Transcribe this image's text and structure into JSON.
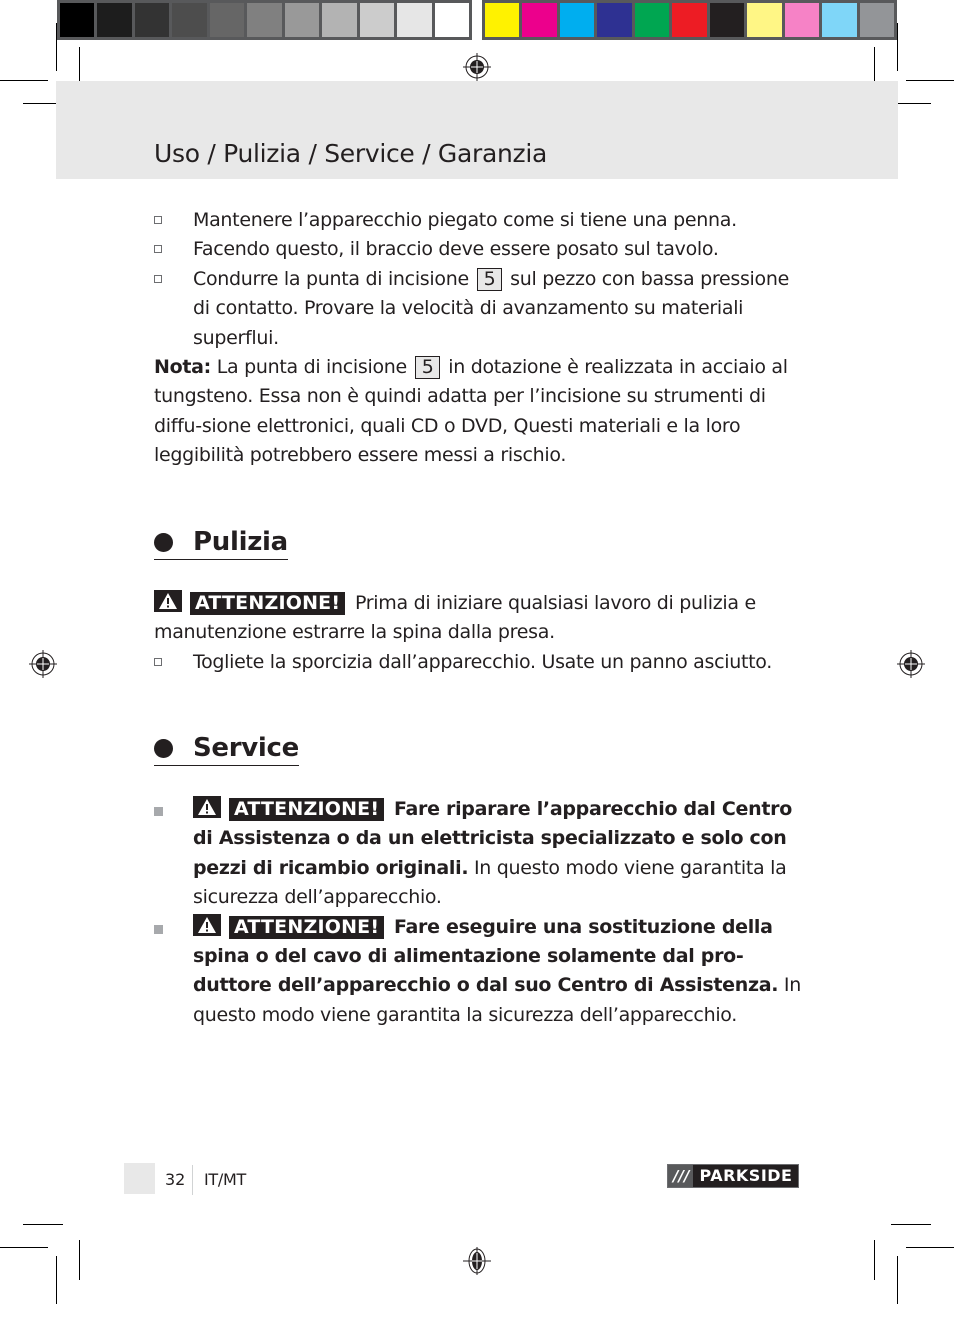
{
  "print_marks": {
    "gray_swatches": [
      "#000000",
      "#1d1d1d",
      "#333333",
      "#4d4d4d",
      "#666666",
      "#808080",
      "#999999",
      "#b3b3b3",
      "#cccccc",
      "#e6e6e6",
      "#ffffff"
    ],
    "color_swatches": [
      "#fff200",
      "#ec008c",
      "#00aeef",
      "#2e3192",
      "#00a651",
      "#ed1c24",
      "#231f20",
      "#fff685",
      "#f682c6",
      "#7fd6f8",
      "#939598"
    ]
  },
  "header": {
    "title": "Uso / Pulizia / Service / Garanzia"
  },
  "uso": {
    "items": [
      {
        "text": "Mantenere l’apparecchio piegato come si tiene una penna."
      },
      {
        "text": "Facendo questo, il braccio deve essere posato sul tavolo."
      },
      {
        "text_before": "Condurre la punta di incisione",
        "ref": "5",
        "text_after": "sul pezzo con bassa pressione di contatto. Provare la velocità di avanzamento su materiali superflui."
      }
    ],
    "note": {
      "label": "Nota:",
      "text_before": "La punta di incisione",
      "ref": "5",
      "text_after": "in dotazione è realizzata in acciaio al tungsteno. Essa non è quindi adatta per l’incisione su strumenti di diffu-sione elettronici, quali CD o DVD, Questi materiali e la loro leggibilità potrebbero essere messi a rischio."
    }
  },
  "pulizia": {
    "heading": "Pulizia",
    "warning_label": "ATTENZIONE!",
    "warning_text": "Prima di iniziare qualsiasi lavoro di pulizia e manutenzione estrarre la spina dalla presa.",
    "items": [
      {
        "text": "Togliete la sporcizia dall’apparecchio. Usate un panno asciutto."
      }
    ]
  },
  "service": {
    "heading": "Service",
    "items": [
      {
        "warning_label": "ATTENZIONE!",
        "bold_text": "Fare riparare l’apparecchio dal Centro di Assistenza o da un elettricista specializzato e solo con pezzi di ricambio originali.",
        "text": "In questo modo viene garantita la sicurezza dell’apparecchio."
      },
      {
        "warning_label": "ATTENZIONE!",
        "bold_text": "Fare eseguire una sostituzione della spina o del cavo di alimentazione solamente dal pro-duttore dell’apparecchio o dal suo Centro di Assistenza.",
        "text": "In questo modo viene garantita la sicurezza dell’apparecchio."
      }
    ]
  },
  "footer": {
    "page_number": "32",
    "locale": "IT/MT",
    "brand_slashes": "///",
    "brand_name": "PARKSIDE"
  }
}
